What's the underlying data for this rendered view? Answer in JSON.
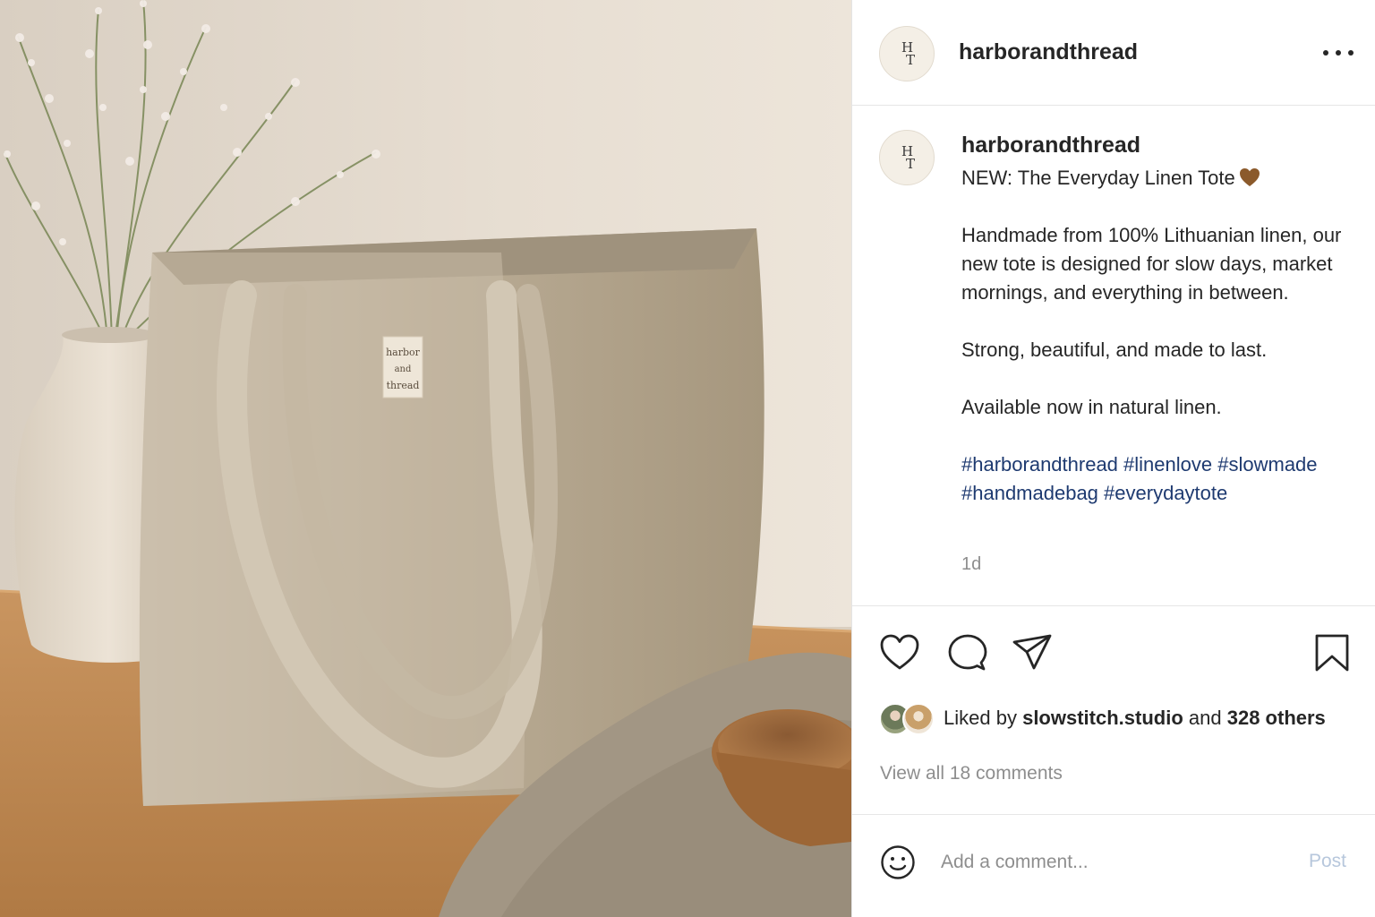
{
  "post": {
    "username": "harborandthread",
    "avatar_monogram": [
      "H",
      "T"
    ],
    "image_label_lines": [
      "harbor",
      "and",
      "thread"
    ]
  },
  "caption": {
    "username": "harborandthread",
    "title": "NEW: The Everyday Linen Tote",
    "title_emoji": "brown-heart-icon",
    "paragraph1": "Handmade from 100% Lithuanian linen, our new tote is designed for slow days, market mornings, and everything in between.",
    "paragraph2": "Strong, beautiful, and made to last.",
    "paragraph3": "Available now in natural linen.",
    "hashtags": [
      "#harborandthread",
      "#linenlove",
      "#slowmade",
      "#handmadebag",
      "#everydaytote"
    ],
    "timestamp": "1d"
  },
  "actions": {
    "icons": [
      "heart-icon",
      "comment-icon",
      "share-icon",
      "bookmark-icon"
    ],
    "liked_by_prefix": "Liked by",
    "liked_by_user": "slowstitch.studio",
    "liked_by_conjunction": "and",
    "liked_by_others": "328 others",
    "view_comments": "View all 18 comments"
  },
  "comment_box": {
    "placeholder": "Add a comment...",
    "post_label": "Post"
  },
  "colors": {
    "hashtag": "#1e3a70",
    "muted": "#8e8e8e",
    "post_disabled": "#b7c7dc"
  }
}
